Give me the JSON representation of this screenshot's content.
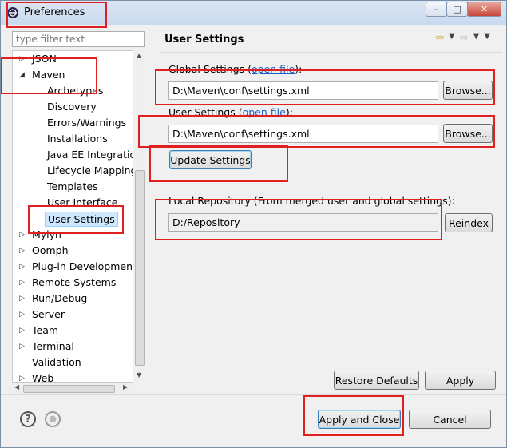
{
  "window": {
    "title": "Preferences",
    "minimize": "–",
    "maximize": "□",
    "close": "✕"
  },
  "filter": {
    "placeholder": "type filter text"
  },
  "tree": {
    "items": [
      {
        "label": "JSON",
        "arrow": "▷",
        "level": 1
      },
      {
        "label": "Maven",
        "arrow": "◢",
        "level": 1
      },
      {
        "label": "Archetypes",
        "level": 2
      },
      {
        "label": "Discovery",
        "level": 2
      },
      {
        "label": "Errors/Warnings",
        "level": 2
      },
      {
        "label": "Installations",
        "level": 2
      },
      {
        "label": "Java EE Integration",
        "level": 2
      },
      {
        "label": "Lifecycle Mapping",
        "level": 2
      },
      {
        "label": "Templates",
        "level": 2
      },
      {
        "label": "User Interface",
        "level": 2
      },
      {
        "label": "User Settings",
        "level": 2,
        "selected": true
      },
      {
        "label": "Mylyn",
        "arrow": "▷",
        "level": 1
      },
      {
        "label": "Oomph",
        "arrow": "▷",
        "level": 1
      },
      {
        "label": "Plug-in Development",
        "arrow": "▷",
        "level": 1
      },
      {
        "label": "Remote Systems",
        "arrow": "▷",
        "level": 1
      },
      {
        "label": "Run/Debug",
        "arrow": "▷",
        "level": 1
      },
      {
        "label": "Server",
        "arrow": "▷",
        "level": 1
      },
      {
        "label": "Team",
        "arrow": "▷",
        "level": 1
      },
      {
        "label": "Terminal",
        "arrow": "▷",
        "level": 1
      },
      {
        "label": "Validation",
        "level": 1
      },
      {
        "label": "Web",
        "arrow": "▷",
        "level": 1
      }
    ]
  },
  "page": {
    "title": "User Settings",
    "global_label": "Global Settings (",
    "global_link": "open file",
    "global_tail": "):",
    "global_value": "D:\\Maven\\conf\\settings.xml",
    "user_label": "User Settings (",
    "user_link": "open file",
    "user_tail": "):",
    "user_value": "D:\\Maven\\conf\\settings.xml",
    "browse_label": "Browse...",
    "update_label": "Update Settings",
    "repo_label": "Local Repository (From merged user and global settings):",
    "repo_value": "D:/Repository",
    "reindex_label": "Reindex"
  },
  "buttons": {
    "restore_defaults": "Restore Defaults",
    "apply": "Apply",
    "apply_close": "Apply and Close",
    "cancel": "Cancel"
  },
  "icons": {
    "help": "?",
    "nav_back": "⇦",
    "nav_forward": "⇨",
    "dropdown": "▼"
  },
  "colors": {
    "highlight": "#e02020",
    "link": "#1a5ec8"
  }
}
